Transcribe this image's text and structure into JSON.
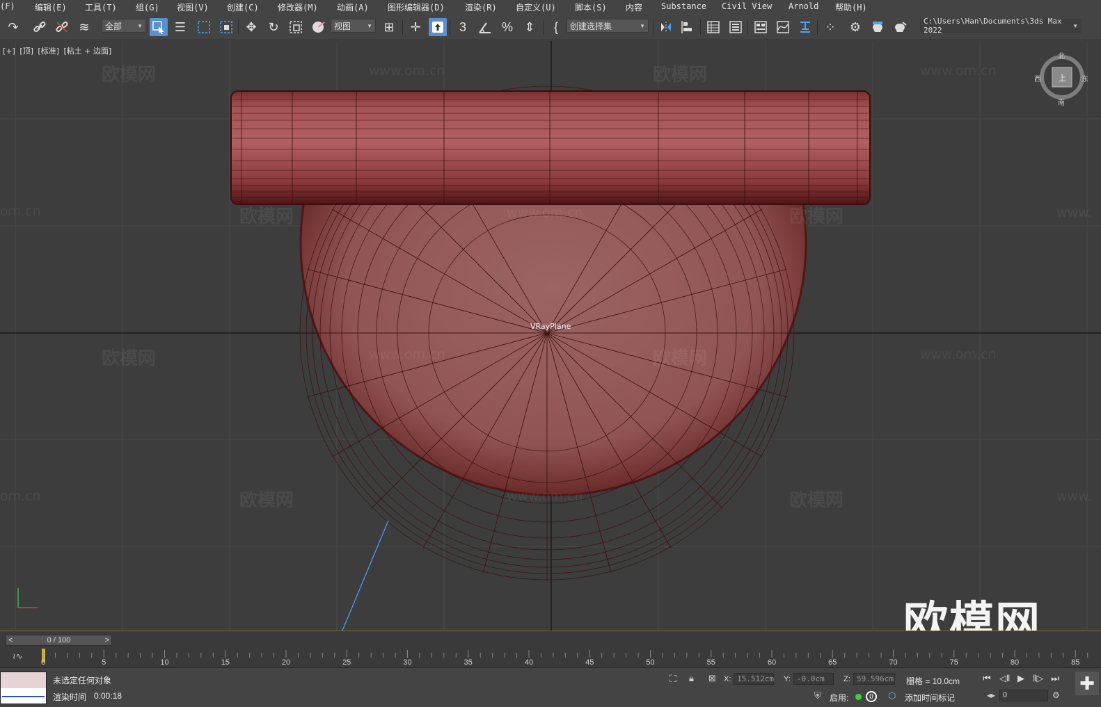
{
  "menu": {
    "items": [
      "(F)",
      "编辑(E)",
      "工具(T)",
      "组(G)",
      "视图(V)",
      "创建(C)",
      "修改器(M)",
      "动画(A)",
      "图形编辑器(D)",
      "渲染(R)",
      "自定义(U)",
      "脚本(S)",
      "内容",
      "Substance",
      "Civil View",
      "Arnold",
      "帮助(H)"
    ]
  },
  "toolbar": {
    "selection_filter": "全部",
    "ref_coord": "视图",
    "named_selection": "创建选择集",
    "project_path": "C:\\Users\\Han\\Documents\\3ds Max 2022"
  },
  "viewport": {
    "label_parts": [
      "[+]",
      "[顶]",
      "[标准]",
      "[粘土 + 边面]"
    ],
    "object_label": "VRayPlane",
    "watermark_text": "欧模网",
    "watermark_url": "www.om.cn",
    "watermark_url_cut": "om.cn",
    "watermark_url_cut_right": "www.",
    "big_watermark": "欧模网",
    "viewcube": {
      "north": "北",
      "south": "南",
      "west": "西",
      "east": "东",
      "face": "上"
    },
    "colors": {
      "object": "#9a5555",
      "background": "#3d3d3d",
      "grid": "#4a4a4a"
    }
  },
  "timeslider": {
    "value": "0 / 100",
    "prev": "<",
    "next": ">"
  },
  "trackbar": {
    "ticks": [
      "0",
      "5",
      "10",
      "15",
      "20",
      "25",
      "30",
      "35",
      "40",
      "45",
      "50",
      "55",
      "60",
      "65",
      "70",
      "75",
      "80",
      "85"
    ]
  },
  "status": {
    "selection_text": "未选定任何对象",
    "render_label": "渲染时间",
    "render_time": "0:00:18",
    "x_label": "X:",
    "x_value": "15.512cm",
    "y_label": "Y:",
    "y_value": "-0.0cm",
    "z_label": "Z:",
    "z_value": "59.596cm",
    "grid": "栅格 = 10.0cm",
    "enable_label": "启用:",
    "enable_count": "0",
    "add_time_tag": "添加时间标记",
    "frame": "0"
  }
}
